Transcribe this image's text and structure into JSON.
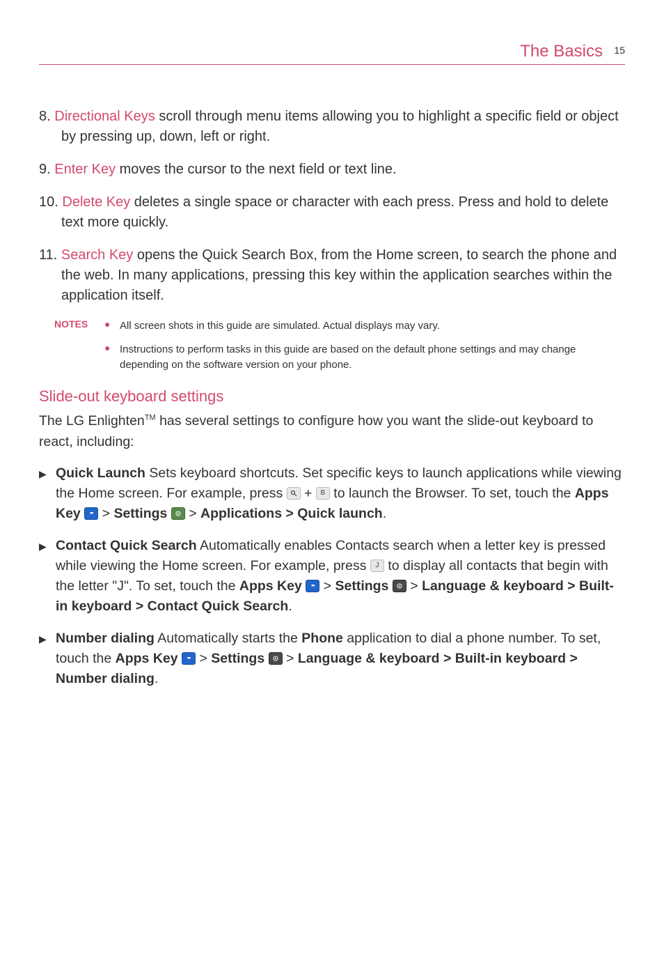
{
  "header": {
    "title": "The Basics",
    "page": "15"
  },
  "items": {
    "i8": {
      "num": "8.",
      "term": "Directional Keys",
      "text": " scroll through menu items allowing you to highlight a specific field or object by pressing up, down, left or right."
    },
    "i9": {
      "num": "9.",
      "term": "Enter Key",
      "text": " moves the cursor to the next field or text line."
    },
    "i10": {
      "num": "10.",
      "term": "Delete Key",
      "text": " deletes a single space or character with each press. Press and hold to delete text more quickly."
    },
    "i11": {
      "num": "11.",
      "term": "Search Key",
      "text": " opens the Quick Search Box, from the Home screen, to search the phone and the web. In many applications, pressing this key within the application searches within the application itself."
    }
  },
  "notes": {
    "label": "NOTES",
    "n1": "All screen shots in this guide are simulated. Actual displays may vary.",
    "n2": "Instructions to perform tasks in this guide are based on the default phone settings and may change depending on the software version on your phone."
  },
  "section": {
    "heading": "Slide-out keyboard settings",
    "intro_a": "The LG Enlighten",
    "intro_tm": "TM",
    "intro_b": " has several settings to configure how you want the slide-out keyboard to react, including:"
  },
  "bullets": {
    "b1": {
      "term": "Quick Launch",
      "t1": " Sets keyboard shortcuts. Set specific keys to launch applications while viewing the Home screen. For example, press ",
      "plus": " + ",
      "t2": " to launch the Browser. To set, touch the ",
      "apps": "Apps Key",
      "gt1": " > ",
      "settings": "Settings",
      "gt2": " > ",
      "path": "Applications > Quick launch",
      "dot": "."
    },
    "b2": {
      "term": "Contact Quick Search",
      "t1": " Automatically enables Contacts search when a letter key is pressed while viewing the Home screen.  For example, press ",
      "t2": " to display all contacts that begin with the letter \"J\".  To set, touch the ",
      "apps": "Apps Key",
      "gt1": " > ",
      "settings": "Settings",
      "gt2": " > ",
      "path": "Language & keyboard > Built-in keyboard > Contact Quick Search",
      "dot": "."
    },
    "b3": {
      "term": "Number dialing",
      "t1": " Automatically starts the ",
      "phone": "Phone",
      "t2": " application to dial a phone number. To set, touch the ",
      "apps": "Apps Key",
      "gt1": " > ",
      "settings": "Settings",
      "gt2": " > ",
      "path": "Language & keyboard > Built-in keyboard > Number dialing",
      "dot": "."
    }
  }
}
